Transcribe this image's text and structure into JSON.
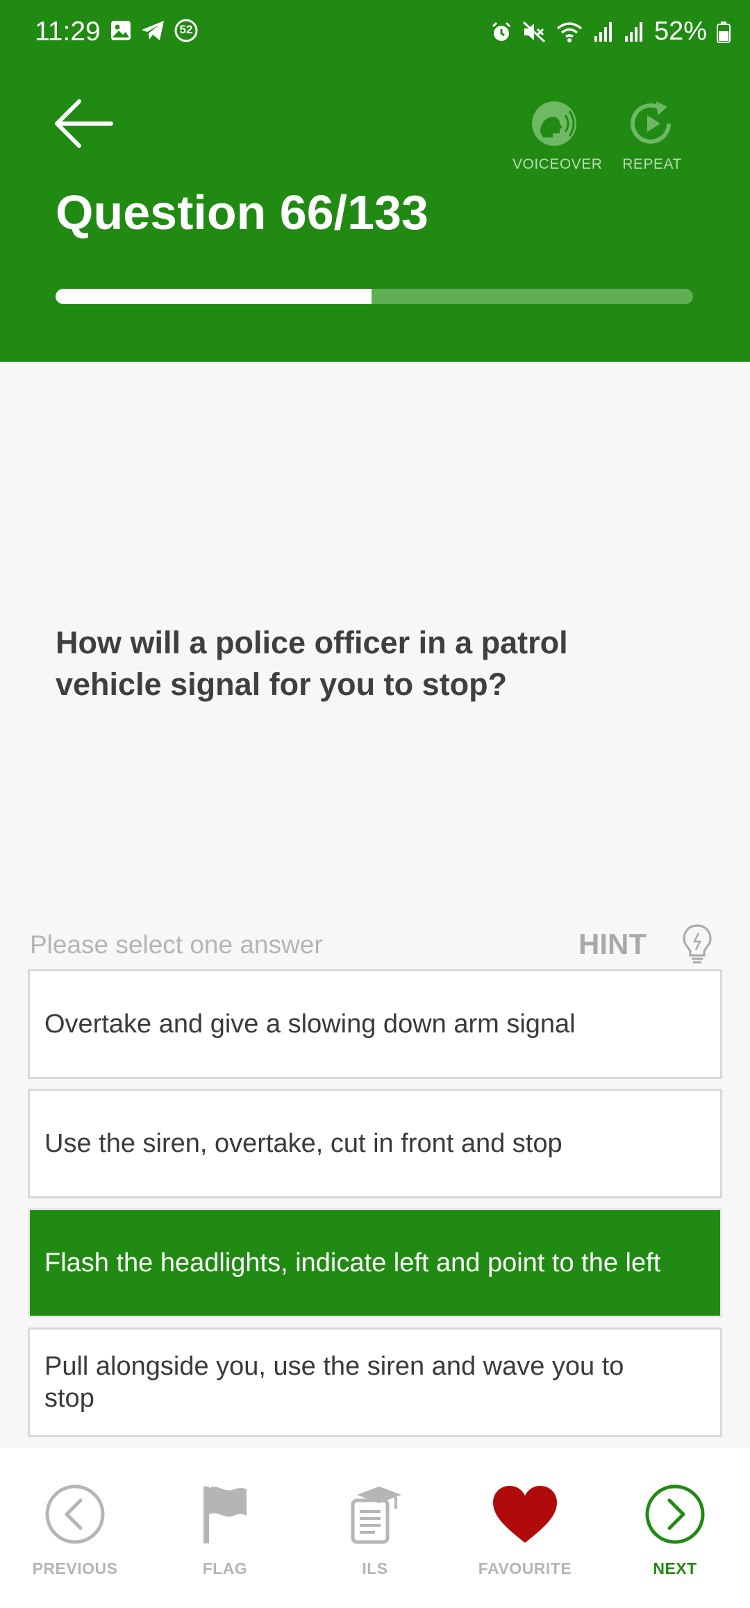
{
  "status": {
    "time": "11:29",
    "notification_count": "52",
    "battery": "52%"
  },
  "header": {
    "title": "Question 66/133",
    "voiceover_label": "VOICEOVER",
    "repeat_label": "REPEAT",
    "progress_fraction": 0.496
  },
  "question": {
    "text": "How will a police officer in a patrol vehicle signal for you to stop?"
  },
  "answers_section": {
    "instruction": "Please select one answer",
    "hint_label": "HINT",
    "answers": [
      {
        "text": "Overtake and give a slowing down arm signal",
        "selected": false
      },
      {
        "text": "Use the siren, overtake, cut in front and stop",
        "selected": false
      },
      {
        "text": "Flash the headlights, indicate left and point to the left",
        "selected": true
      },
      {
        "text": "Pull alongside you, use the siren and wave you to stop",
        "selected": false
      }
    ]
  },
  "bottom_nav": {
    "previous": "PREVIOUS",
    "flag": "FLAG",
    "ils": "ILS",
    "favourite": "FAVOURITE",
    "next": "NEXT"
  },
  "colors": {
    "brand_green": "#218a13",
    "favourite_red": "#b00a0a"
  }
}
